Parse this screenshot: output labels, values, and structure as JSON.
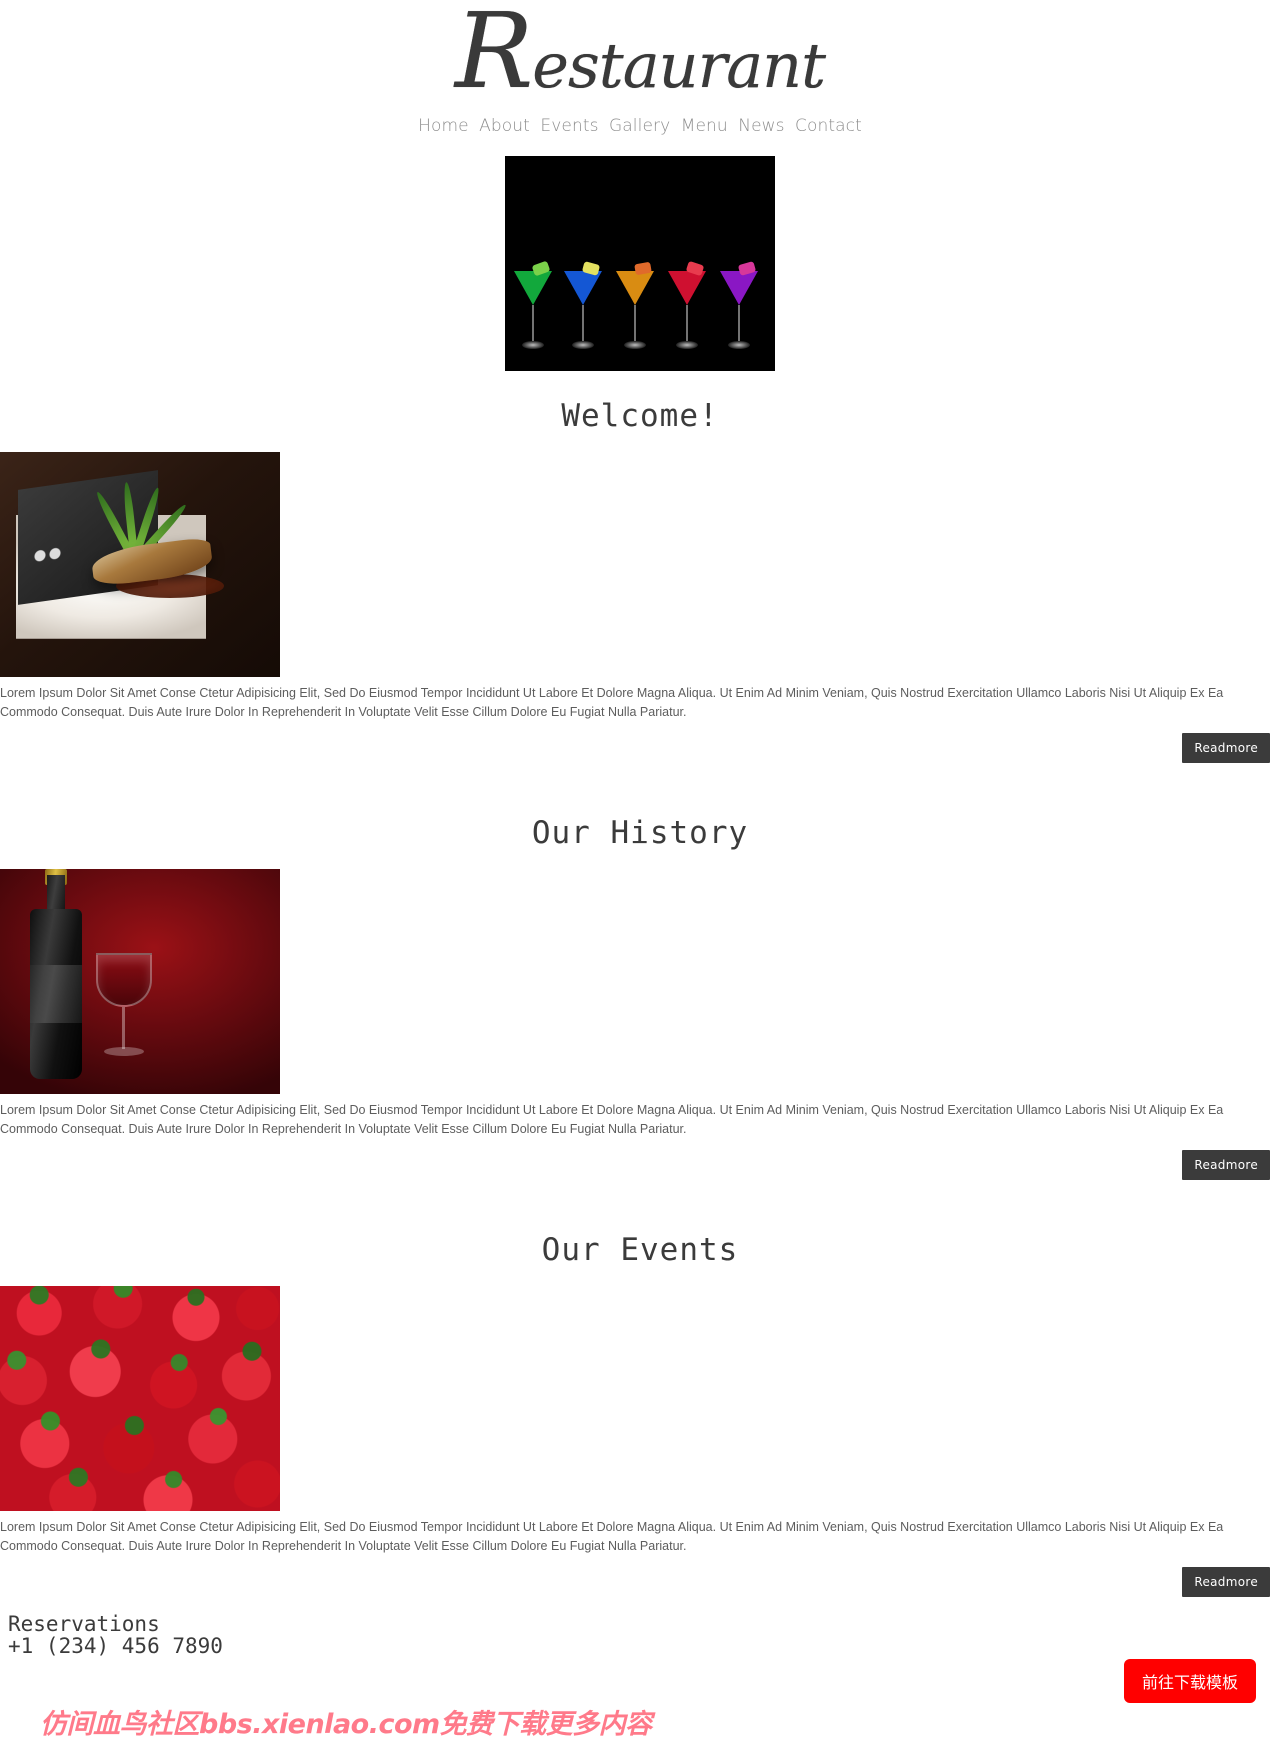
{
  "site": {
    "logo_text": "Restaurant",
    "logo_icon": "script-logo"
  },
  "nav": {
    "items": [
      {
        "label": "Home"
      },
      {
        "label": "About"
      },
      {
        "label": "Events"
      },
      {
        "label": "Gallery"
      },
      {
        "label": "Menu"
      },
      {
        "label": "News"
      },
      {
        "label": "Contact"
      }
    ]
  },
  "hero": {
    "image_alt": "five colorful cocktail glasses on black background"
  },
  "sections": [
    {
      "title": "Welcome!",
      "image_alt": "grilled fish on a white plate with slate and bamboo leaves",
      "body": "Lorem Ipsum Dolor Sit Amet Conse Ctetur Adipisicing Elit, Sed Do Eiusmod Tempor Incididunt Ut Labore Et Dolore Magna Aliqua. Ut Enim Ad Minim Veniam, Quis Nostrud Exercitation Ullamco Laboris Nisi Ut Aliquip Ex Ea Commodo Consequat. Duis Aute Irure Dolor In Reprehenderit In Voluptate Velit Esse Cillum Dolore Eu Fugiat Nulla Pariatur.",
      "button_label": "Readmore"
    },
    {
      "title": "Our History",
      "image_alt": "wine bottle and filled wine glass on red background",
      "body": "Lorem Ipsum Dolor Sit Amet Conse Ctetur Adipisicing Elit, Sed Do Eiusmod Tempor Incididunt Ut Labore Et Dolore Magna Aliqua. Ut Enim Ad Minim Veniam, Quis Nostrud Exercitation Ullamco Laboris Nisi Ut Aliquip Ex Ea Commodo Consequat. Duis Aute Irure Dolor In Reprehenderit In Voluptate Velit Esse Cillum Dolore Eu Fugiat Nulla Pariatur.",
      "button_label": "Readmore"
    },
    {
      "title": "Our Events",
      "image_alt": "close-up of many ripe strawberries",
      "body": "Lorem Ipsum Dolor Sit Amet Conse Ctetur Adipisicing Elit, Sed Do Eiusmod Tempor Incididunt Ut Labore Et Dolore Magna Aliqua. Ut Enim Ad Minim Veniam, Quis Nostrud Exercitation Ullamco Laboris Nisi Ut Aliquip Ex Ea Commodo Consequat. Duis Aute Irure Dolor In Reprehenderit In Voluptate Velit Esse Cillum Dolore Eu Fugiat Nulla Pariatur.",
      "button_label": "Readmore"
    }
  ],
  "footer": {
    "reservations_title": "Reservations",
    "reservations_phone": "+1  (234) 456 7890"
  },
  "overlay": {
    "watermark_text": "仿间血鸟社区bbs.xienlao.com免费下载更多内容",
    "download_button_label": "前往下载模板",
    "download_button_color": "#ff0000",
    "watermark_color": "#f4606f"
  }
}
